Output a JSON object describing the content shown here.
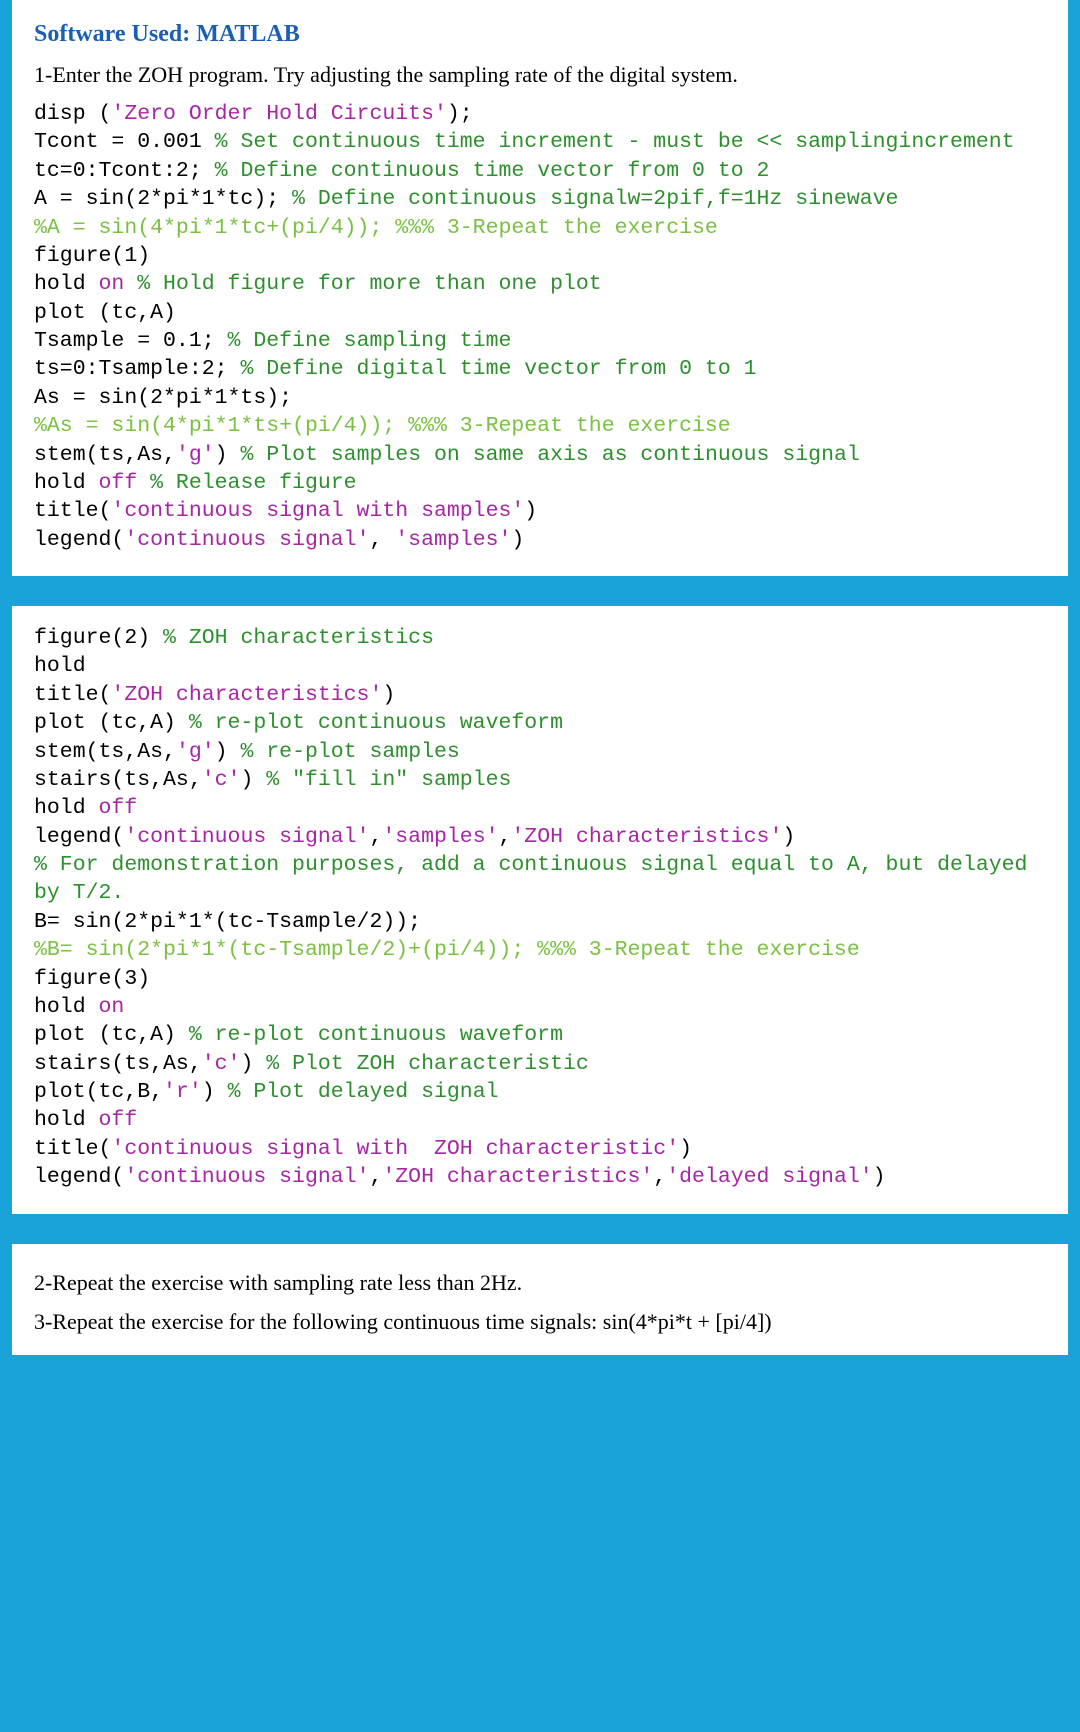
{
  "heading": "Software Used: MATLAB",
  "intro": "1-Enter the ZOH program. Try adjusting the sampling rate of the digital system.",
  "code1": {
    "c1a": "disp (",
    "c1b": "'Zero Order Hold Circuits'",
    "c1c": ");",
    "c2a": "Tcont = 0.001 ",
    "c2b": "% Set continuous time increment - must be << samplingincrement",
    "c3a": "tc=0:Tcont:2; ",
    "c3b": "% Define continuous time vector from 0 to 2",
    "c4a": "A = sin(2*pi*1*tc); ",
    "c4b": "% Define continuous signalw=2pif,f=1Hz sinewave",
    "c5": "%A = sin(4*pi*1*tc+(pi/4)); %%% 3-Repeat the exercise",
    "c6": "figure(1)",
    "c7a": "hold ",
    "c7b": "on ",
    "c7c": "% Hold figure for more than one plot",
    "c8": "plot (tc,A)",
    "c9a": "Tsample = 0.1; ",
    "c9b": "% Define sampling time",
    "c10a": "ts=0:Tsample:2; ",
    "c10b": "% Define digital time vector from 0 to 1",
    "c11": "As = sin(2*pi*1*ts);",
    "c12": "%As = sin(4*pi*1*ts+(pi/4)); %%% 3-Repeat the exercise",
    "c13a": "stem(ts,As,",
    "c13b": "'g'",
    "c13c": ") ",
    "c13d": "% Plot samples on same axis as continuous signal",
    "c14a": "hold ",
    "c14b": "off ",
    "c14c": "% Release figure",
    "c15a": "title(",
    "c15b": "'continuous signal with samples'",
    "c15c": ")",
    "c16a": "legend(",
    "c16b": "'continuous signal'",
    "c16c": ", ",
    "c16d": "'samples'",
    "c16e": ")"
  },
  "code2": {
    "d1a": "figure(2) ",
    "d1b": "% ZOH characteristics",
    "d2": "hold",
    "d3a": "title(",
    "d3b": "'ZOH characteristics'",
    "d3c": ")",
    "d4a": "plot (tc,A) ",
    "d4b": "% re-plot continuous waveform",
    "d5a": "stem(ts,As,",
    "d5b": "'g'",
    "d5c": ") ",
    "d5d": "% re-plot samples",
    "d6a": "stairs(ts,As,",
    "d6b": "'c'",
    "d6c": ") ",
    "d6d": "% \"fill in\" samples",
    "d7a": "hold ",
    "d7b": "off",
    "d8a": "legend(",
    "d8b": "'continuous signal'",
    "d8c": ",",
    "d8d": "'samples'",
    "d8e": ",",
    "d8f": "'ZOH characteristics'",
    "d8g": ")",
    "d9": "% For demonstration purposes, add a continuous signal equal to A, but delayed by T/2.",
    "d10": "B= sin(2*pi*1*(tc-Tsample/2));",
    "d11": "%B= sin(2*pi*1*(tc-Tsample/2)+(pi/4)); %%% 3-Repeat the exercise",
    "d12": "figure(3)",
    "d13a": "hold ",
    "d13b": "on",
    "d14a": "plot (tc,A) ",
    "d14b": "% re-plot continuous waveform",
    "d15a": "stairs(ts,As,",
    "d15b": "'c'",
    "d15c": ") ",
    "d15d": "% Plot ZOH characteristic",
    "d16a": "plot(tc,B,",
    "d16b": "'r'",
    "d16c": ") ",
    "d16d": "% Plot delayed signal",
    "d17a": "hold ",
    "d17b": "off",
    "d18a": "title(",
    "d18b": "'continuous signal with  ZOH characteristic'",
    "d18c": ")",
    "d19a": "legend(",
    "d19b": "'continuous signal'",
    "d19c": ",",
    "d19d": "'ZOH characteristics'",
    "d19e": ",",
    "d19f": "'delayed signal'",
    "d19g": ")"
  },
  "q2": "2-Repeat the exercise with sampling rate less than 2Hz.",
  "q3": "3-Repeat the exercise for the following continuous time signals: sin(4*pi*t + [pi/4])"
}
